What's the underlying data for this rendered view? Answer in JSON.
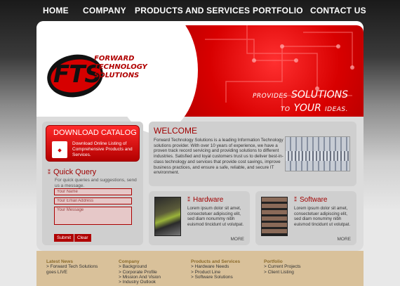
{
  "nav": {
    "items": [
      "HOME",
      "COMPANY",
      "PRODUCTS AND SERVICES",
      "PORTFOLIO",
      "CONTACT US"
    ]
  },
  "logo": {
    "mark": "FTS",
    "line1": "FORWARD",
    "line2": "TECHNOLOGY",
    "line3": "SOLUTIONS"
  },
  "banner": {
    "tag1_small": "PROVIDES",
    "tag1_big": "SOLUTIONS",
    "tag2_small": "TO",
    "tag2_big": "YOUR",
    "tag2_end": "IDEAS."
  },
  "download": {
    "title": "DOWNLOAD CATALOG",
    "text": "Download Online Listing of Comprehensive Products and Services.",
    "icon": "pdf-icon"
  },
  "quick_inquiry": {
    "title": "Quick Query",
    "desc": "For quick queries and suggestions, send us a message.",
    "name_placeholder": "Your Name",
    "email_placeholder": "Your Email Address",
    "message_placeholder": "Your Message",
    "submit": "Submit",
    "clear": "Clear"
  },
  "welcome": {
    "title": "WELCOME",
    "text": "Forward Technology Solutions is a leading Information Technology solutions provider. With over 10 years of experience, we have a proven track record servicing and providing solutions to different industries. Satisfied and loyal customers trust us to deliver best-in-class technology and services that provide cost savings, improve business practices, and ensure a safe, reliable, and secure IT environment."
  },
  "hardware": {
    "title": "Hardware",
    "text": "Lorem ipsum dolor sit amet, consectetuer adipiscing elit, sed diam nonummy nibh euismod tincidunt ut volutpat.",
    "more": "MORE"
  },
  "software": {
    "title": "Software",
    "text": "Lorem ipsum dolor sit amet, consectetuer adipiscing elit, sed diam nonummy nibh euismod tincidunt ut volutpat.",
    "more": "MORE"
  },
  "footer": {
    "cols": [
      {
        "head": "Latest News",
        "items": [
          "> Forward Tech Solutions",
          "goes LIVE"
        ]
      },
      {
        "head": "Company",
        "items": [
          "> Background",
          "> Corporate Profile",
          "> Mission And Vision",
          "> Industry Outlook"
        ]
      },
      {
        "head": "Products and Services",
        "items": [
          "> Hardware Needs",
          "> Product Line",
          "> Software Solutions"
        ]
      },
      {
        "head": "Portfolio",
        "items": [
          "> Current Projects",
          "> Client Listing"
        ]
      }
    ]
  },
  "colors": {
    "brand_red": "#a00000",
    "banner_red": "#d80000",
    "footer_tan": "#d9c19a"
  }
}
